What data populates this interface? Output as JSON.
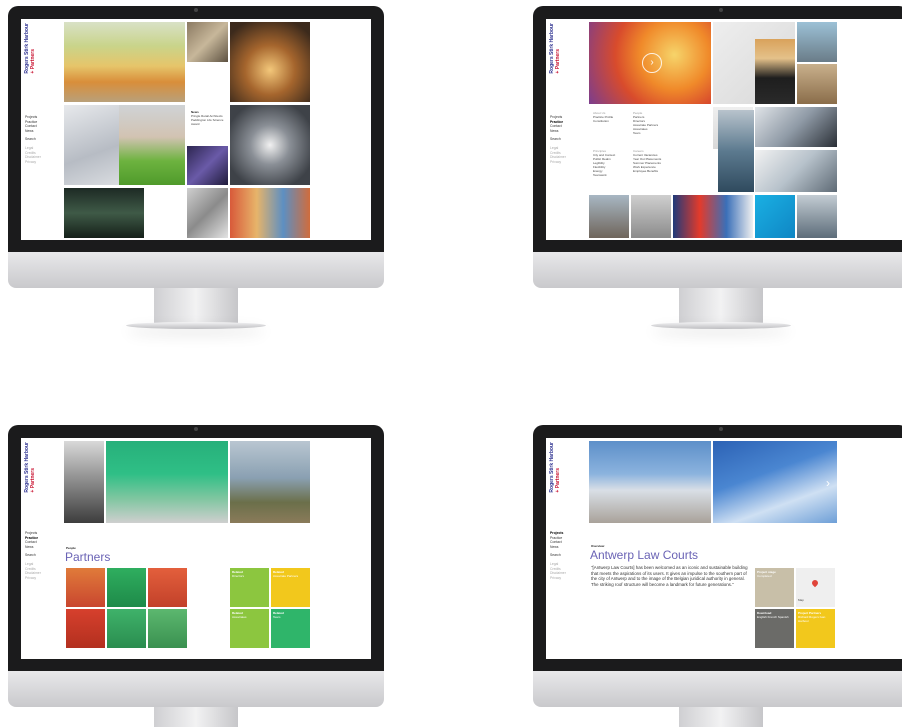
{
  "brand": {
    "line1": "Rogers Stirk Harbour",
    "line2": "+ Partners"
  },
  "screen1": {
    "nav_primary": [
      "Projects",
      "Practice",
      "Contact",
      "News"
    ],
    "nav_search": "Search",
    "nav_secondary": [
      "Legal",
      "Credits",
      "Disclaimer",
      "Privacy"
    ],
    "news": {
      "heading": "News",
      "body": "Pringle Retail Architects Paddington Life Science Award"
    }
  },
  "screen2": {
    "nav_primary": [
      "Projects",
      "Practice",
      "Contact",
      "News"
    ],
    "nav_search": "Search",
    "nav_secondary": [
      "Legal",
      "Credits",
      "Disclaimer",
      "Privacy"
    ],
    "about": {
      "heading": "About Us",
      "items": [
        "Practice Profile",
        "Constitution"
      ]
    },
    "people": {
      "heading": "People",
      "items": [
        "Partners",
        "Directors",
        "Associate Partners",
        "Associates",
        "Team"
      ]
    },
    "principles": {
      "heading": "Principles",
      "items": [
        "City and Context",
        "Public Realm",
        "Legibility",
        "Flexibility",
        "Energy",
        "Teamwork"
      ]
    },
    "careers": {
      "heading": "Careers",
      "items": [
        "Current Vacancies",
        "Year Out Placements",
        "Summer Placements",
        "Work Experience",
        "Employee Benefits"
      ]
    }
  },
  "screen3": {
    "nav_primary": [
      "Projects",
      "Practice",
      "Contact",
      "News"
    ],
    "nav_search": "Search",
    "nav_secondary": [
      "Legal",
      "Credits",
      "Disclaimer",
      "Privacy"
    ],
    "section": "People",
    "title": "Partners",
    "related": [
      {
        "heading": "Related",
        "body": "Directors",
        "color": "#8cc63f"
      },
      {
        "heading": "Related",
        "body": "Associate Partners",
        "color": "#f2c81c"
      },
      {
        "heading": "Related",
        "body": "Associates",
        "color": "#8cc63f"
      },
      {
        "heading": "Related",
        "body": "Team",
        "color": "#2fb56a"
      }
    ]
  },
  "screen4": {
    "nav_primary": [
      "Projects",
      "Practice",
      "Contact",
      "News"
    ],
    "nav_search": "Search",
    "nav_secondary": [
      "Legal",
      "Credits",
      "Disclaimer",
      "Privacy"
    ],
    "section": "Overview",
    "title": "Antwerp Law Courts",
    "quote": "\"[Antwerp Law Courts] has been welcomed as an iconic and sustainable building that meets the aspirations of its users. It gives an impulse to the southern part of the city of Antwerp and to the image of the Belgian juridical authority in general. The striking roof structure will become a landmark for future generations.\"",
    "cards": [
      {
        "heading": "Project stage",
        "body": "Completed",
        "color": "#c8bfa8"
      },
      {
        "heading": "Map",
        "body": "",
        "color": "#efefef"
      },
      {
        "heading": "Download",
        "body": "English French Spanish",
        "color": "#6b6b68"
      },
      {
        "heading": "Project Partners",
        "body": "Richard Rogers Ivan Harbour",
        "color": "#f2c81c"
      }
    ]
  }
}
